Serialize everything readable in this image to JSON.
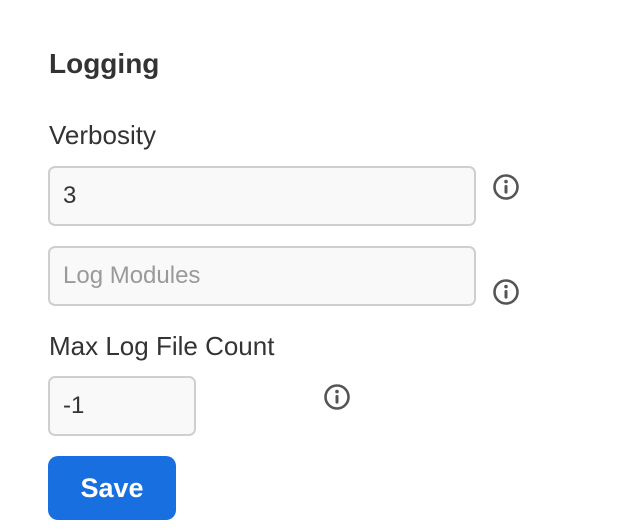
{
  "logging": {
    "title": "Logging",
    "verbosity": {
      "label": "Verbosity",
      "value": "3",
      "placeholder": ""
    },
    "log_modules": {
      "label": "",
      "value": "",
      "placeholder": "Log Modules"
    },
    "max_log_file_count": {
      "label": "Max Log File Count",
      "value": "-1",
      "placeholder": ""
    },
    "save_label": "Save"
  },
  "icons": {
    "info": "info-circle-icon"
  },
  "colors": {
    "primary": "#176fe0",
    "text": "#333333",
    "input_border": "#cfcfcf",
    "input_background": "#f9f9f9",
    "placeholder": "#9a9a9a",
    "icon": "#555555"
  }
}
